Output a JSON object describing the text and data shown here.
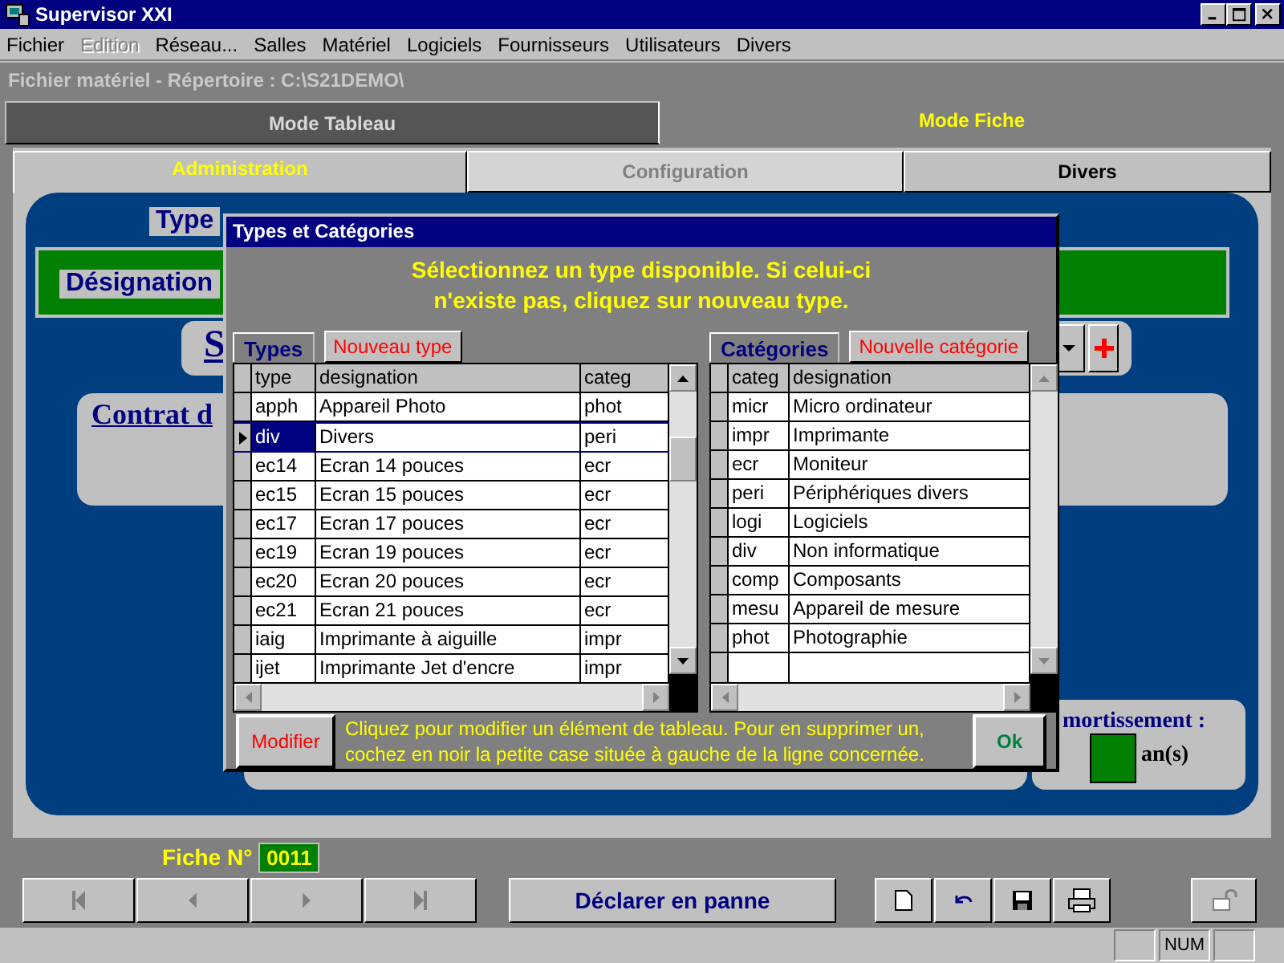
{
  "window": {
    "title": "Supervisor XXI"
  },
  "menu": [
    {
      "label": "Fichier",
      "disabled": false
    },
    {
      "label": "Edition",
      "disabled": true
    },
    {
      "label": "Réseau...",
      "disabled": false
    },
    {
      "label": "Salles",
      "disabled": false
    },
    {
      "label": "Matériel",
      "disabled": false
    },
    {
      "label": "Logiciels",
      "disabled": false
    },
    {
      "label": "Fournisseurs",
      "disabled": false
    },
    {
      "label": "Utilisateurs",
      "disabled": false
    },
    {
      "label": "Divers",
      "disabled": false
    }
  ],
  "path_bar": "Fichier matériel - Répertoire : C:\\S21DEMO\\",
  "mode_tabs": [
    {
      "label": "Mode Tableau",
      "selected": false
    },
    {
      "label": "Mode Fiche",
      "selected": true
    }
  ],
  "sub_tabs": [
    {
      "label": "Administration",
      "selected": true,
      "disabled": false
    },
    {
      "label": "Configuration",
      "selected": false,
      "disabled": true
    },
    {
      "label": "Divers",
      "selected": false,
      "disabled": false
    }
  ],
  "form": {
    "type_label": "Type",
    "designation_label": "Désignation",
    "section_label": "S",
    "contract_label": "Contrat d",
    "amortization_label": "mortissement :",
    "amortization_unit": "an(s)"
  },
  "dialog": {
    "title": "Types et Catégories",
    "message": "Sélectionnez un type disponible. Si celui-ci n'existe pas, cliquez sur nouveau type.",
    "types_tab": "Types",
    "new_type_button": "Nouveau type",
    "types_table": {
      "columns": [
        "type",
        "designation",
        "categ"
      ],
      "rows": [
        {
          "cells": [
            "apph",
            "Appareil Photo",
            "phot"
          ],
          "selected": false
        },
        {
          "cells": [
            "div",
            "Divers",
            "peri"
          ],
          "selected": true
        },
        {
          "cells": [
            "ec14",
            "Ecran 14 pouces",
            "ecr"
          ],
          "selected": false
        },
        {
          "cells": [
            "ec15",
            "Ecran 15 pouces",
            "ecr"
          ],
          "selected": false
        },
        {
          "cells": [
            "ec17",
            "Ecran 17 pouces",
            "ecr"
          ],
          "selected": false
        },
        {
          "cells": [
            "ec19",
            "Ecran 19 pouces",
            "ecr"
          ],
          "selected": false
        },
        {
          "cells": [
            "ec20",
            "Ecran 20 pouces",
            "ecr"
          ],
          "selected": false
        },
        {
          "cells": [
            "ec21",
            "Ecran 21 pouces",
            "ecr"
          ],
          "selected": false
        },
        {
          "cells": [
            "iaig",
            "Imprimante à aiguille",
            "impr"
          ],
          "selected": false
        },
        {
          "cells": [
            "ijet",
            "Imprimante Jet d'encre",
            "impr"
          ],
          "selected": false
        }
      ]
    },
    "categories_tab": "Catégories",
    "new_category_button": "Nouvelle catégorie",
    "categories_table": {
      "columns": [
        "categ",
        "designation"
      ],
      "rows": [
        {
          "cells": [
            "micr",
            "Micro ordinateur"
          ],
          "selected": false
        },
        {
          "cells": [
            "impr",
            "Imprimante"
          ],
          "selected": false
        },
        {
          "cells": [
            "ecr",
            "Moniteur"
          ],
          "selected": false
        },
        {
          "cells": [
            "peri",
            "Périphériques divers"
          ],
          "selected": false
        },
        {
          "cells": [
            "logi",
            "Logiciels"
          ],
          "selected": false
        },
        {
          "cells": [
            "div",
            "Non informatique"
          ],
          "selected": false
        },
        {
          "cells": [
            "comp",
            "Composants"
          ],
          "selected": false
        },
        {
          "cells": [
            "mesu",
            "Appareil de mesure"
          ],
          "selected": false
        },
        {
          "cells": [
            "phot",
            "Photographie"
          ],
          "selected": false
        }
      ]
    },
    "modify_button": "Modifier",
    "hint": "Cliquez pour modifier un élément de tableau. Pour en supprimer un, cochez en noir la petite case située à gauche de la ligne concernée.",
    "ok_button": "Ok"
  },
  "record": {
    "label": "Fiche N°",
    "number": "0011"
  },
  "breakdown_button": "Déclarer en panne",
  "status_bar": {
    "num": "NUM"
  }
}
